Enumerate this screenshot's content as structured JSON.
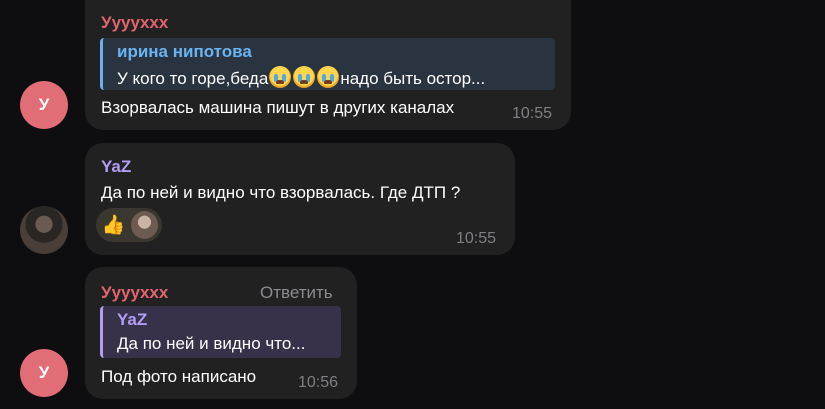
{
  "messages": [
    {
      "sender": "Уууyххх",
      "sender_color": "#e1646f",
      "avatar_letter": "У",
      "quote": {
        "name": "ирина нипотова",
        "text_before": "У кого то горе,беда",
        "text_after": "надо быть остор...",
        "accent": "#6ab3f3",
        "background": "#2a3440"
      },
      "text": "Взорвалась машина пишут в других каналах",
      "time": "10:55"
    },
    {
      "sender": "YaZ",
      "sender_color": "#b49cf6",
      "text": "Да по ней и видно что взорвалась. Где ДТП ?",
      "reactions": [
        "thumbs-up-icon",
        "user-avatar-reaction"
      ],
      "time": "10:55"
    },
    {
      "sender": "Уууyххх",
      "sender_color": "#e1646f",
      "avatar_letter": "У",
      "reply_action": "Ответить",
      "quote": {
        "name": "YaZ",
        "text": "Да по ней и видно что...",
        "accent": "#b49cf6",
        "background": "#37324a"
      },
      "text": "Под фото написано",
      "time": "10:56"
    }
  ]
}
